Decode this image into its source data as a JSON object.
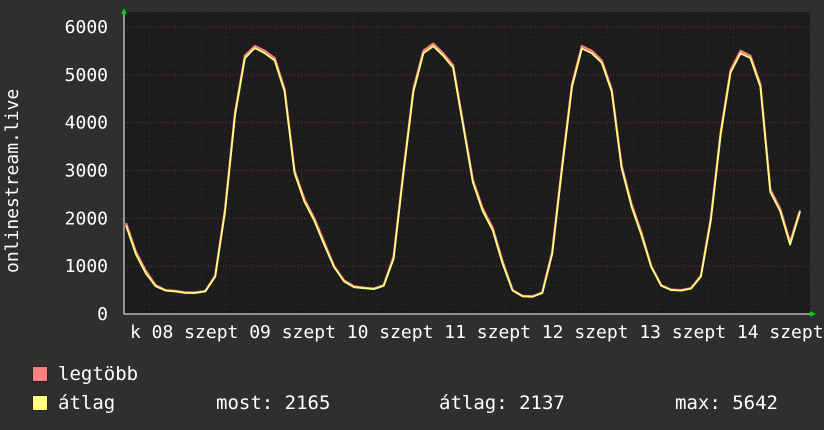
{
  "chart_data": {
    "type": "line",
    "ylabel": "onlinestream.live",
    "ylim": [
      0,
      6000
    ],
    "yticks": [
      "0",
      "1000",
      "2000",
      "3000",
      "4000",
      "5000",
      "6000"
    ],
    "xticks": [
      "k 08 szept 09 szept 10 szept 11 szept 12 szept 13 szept 14 szept"
    ],
    "grid": true,
    "legend_placement": "bottom-left",
    "colors": {
      "background": "#1c1c1c",
      "grid": "#5a2a2a",
      "legtobb": "#ff8080",
      "atlag": "#ffff80",
      "axis": "#ffffff"
    },
    "x_points": 69,
    "series": [
      {
        "name": "legtöbb",
        "values": [
          1900,
          1300,
          900,
          600,
          500,
          480,
          450,
          450,
          480,
          800,
          2200,
          4200,
          5400,
          5600,
          5500,
          5350,
          4700,
          3000,
          2400,
          2000,
          1500,
          1000,
          700,
          580,
          550,
          530,
          600,
          1200,
          3000,
          4700,
          5500,
          5650,
          5450,
          5200,
          4000,
          2800,
          2200,
          1800,
          1100,
          500,
          380,
          370,
          450,
          1300,
          3100,
          4800,
          5600,
          5500,
          5300,
          4700,
          3100,
          2300,
          1700,
          1000,
          600,
          510,
          500,
          540,
          800,
          2000,
          3800,
          5100,
          5500,
          5400,
          4800,
          2600,
          2200,
          1500,
          2165
        ]
      },
      {
        "name": "átlag",
        "values": [
          1850,
          1250,
          850,
          580,
          490,
          470,
          440,
          440,
          470,
          780,
          2150,
          4150,
          5350,
          5560,
          5450,
          5300,
          4650,
          2950,
          2350,
          1950,
          1450,
          980,
          680,
          560,
          540,
          520,
          590,
          1150,
          2950,
          4650,
          5450,
          5600,
          5400,
          5150,
          3950,
          2750,
          2150,
          1750,
          1050,
          490,
          370,
          360,
          440,
          1250,
          3050,
          4750,
          5550,
          5450,
          5250,
          4650,
          3050,
          2250,
          1650,
          980,
          590,
          500,
          490,
          530,
          780,
          1950,
          3750,
          5050,
          5450,
          5350,
          4750,
          2550,
          2150,
          1450,
          2137
        ]
      }
    ]
  },
  "legend": {
    "items": [
      {
        "label": "legtöbb",
        "color": "#ff8080"
      },
      {
        "label": "átlag",
        "color": "#ffff80"
      }
    ],
    "stats": {
      "most": "most: 2165",
      "atlag": "átlag: 2137",
      "max": "max: 5642"
    }
  }
}
